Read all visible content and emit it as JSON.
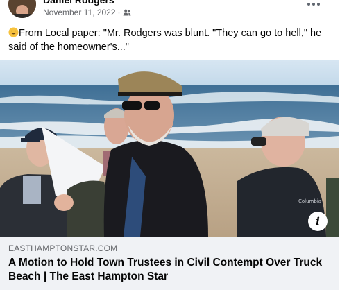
{
  "post": {
    "author": "Daniel Rodgers",
    "date": "November 11, 2022",
    "separator": "·",
    "audience_icon": "friends-icon",
    "more_icon": "more-horizontal-icon",
    "emoji": "grinning-face-emoji",
    "text": "From Local paper: \"Mr. Rodgers was blunt. \"They can go to hell,\" he said of the homeowner's...\""
  },
  "link_preview": {
    "info_label": "i",
    "domain": "EASTHAMPTONSTAR.COM",
    "title": "A Motion to Hold Town Trustees in Civil Contempt Over Truck Beach | The East Hampton Star"
  },
  "colors": {
    "text_primary": "#050505",
    "text_secondary": "#65676b",
    "caption_background": "#f0f2f5"
  }
}
